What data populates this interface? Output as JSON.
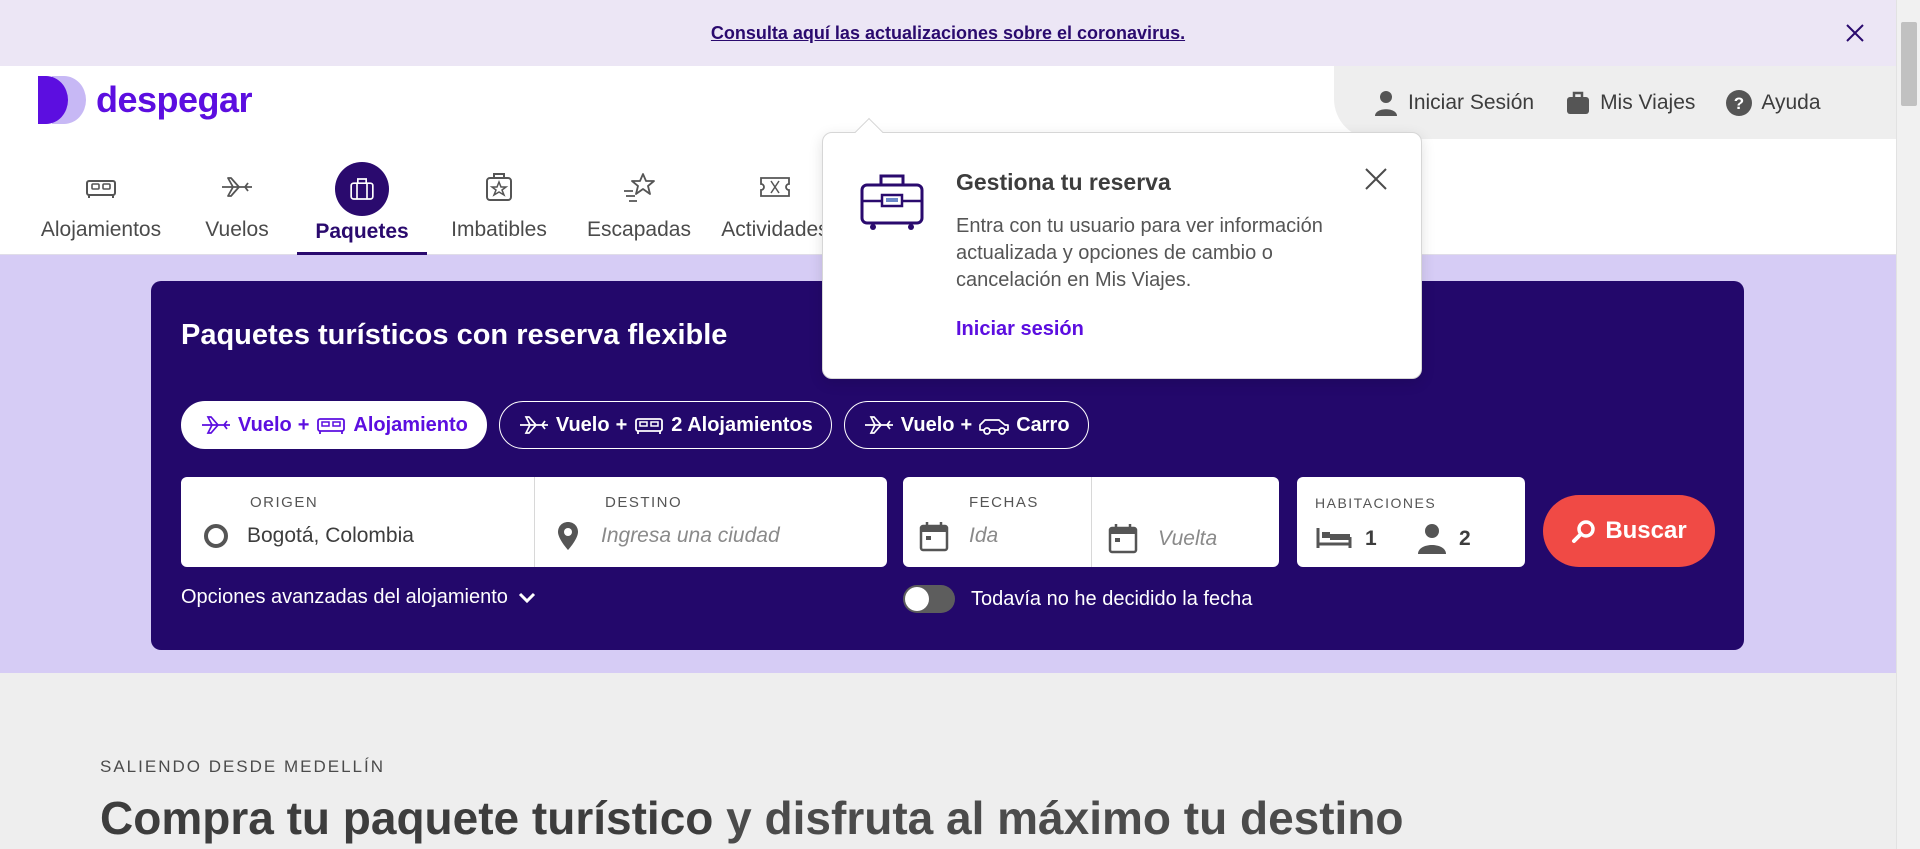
{
  "banner": {
    "text": "Consulta aquí las actualizaciones sobre el coronavirus."
  },
  "logo": {
    "text": "despegar"
  },
  "user_nav": [
    {
      "label": "Iniciar Sesión",
      "icon": "user-icon"
    },
    {
      "label": "Mis Viajes",
      "icon": "suitcase-icon"
    },
    {
      "label": "Ayuda",
      "icon": "help-icon"
    }
  ],
  "tabs": [
    {
      "label": "Alojamientos",
      "icon": "bed-icon"
    },
    {
      "label": "Vuelos",
      "icon": "plane-icon"
    },
    {
      "label": "Paquetes",
      "icon": "suitcase-icon",
      "active": true
    },
    {
      "label": "Imbatibles",
      "icon": "star-badge-icon"
    },
    {
      "label": "Escapadas",
      "icon": "shooting-star-icon"
    },
    {
      "label": "Actividades",
      "icon": "ticket-icon"
    }
  ],
  "search": {
    "title": "Paquetes turísticos con reserva flexible",
    "pills": [
      {
        "a": "Vuelo",
        "plus": "+",
        "b": "Alojamiento"
      },
      {
        "a": "Vuelo",
        "plus": "+",
        "b": "2 Alojamientos"
      },
      {
        "a": "Vuelo",
        "plus": "+",
        "b": "Carro"
      }
    ],
    "origin": {
      "label": "ORIGEN",
      "value": "Bogotá, Colombia"
    },
    "destination": {
      "label": "DESTINO",
      "placeholder": "Ingresa una ciudad"
    },
    "dates": {
      "label": "FECHAS",
      "from_placeholder": "Ida",
      "to_placeholder": "Vuelta"
    },
    "rooms": {
      "label": "HABITACIONES",
      "rooms": "1",
      "people": "2"
    },
    "button": "Buscar",
    "advanced": "Opciones avanzadas del alojamiento",
    "undecided": "Todavía no he decidido la fecha"
  },
  "popover": {
    "title": "Gestiona tu reserva",
    "body": "Entra con tu usuario para ver información actualizada y opciones de cambio o cancelación en Mis Viajes.",
    "link": "Iniciar sesión"
  },
  "section": {
    "kicker": "SALIENDO DESDE MEDELLÍN",
    "headline_bold": "Compra tu paquete turístico",
    "headline_rest": " y disfruta al máximo tu destino"
  },
  "colors": {
    "brand": "#5c0ee0",
    "dark": "#23086b",
    "accent": "#f04a45",
    "hero_bg": "#d6ccf5"
  }
}
